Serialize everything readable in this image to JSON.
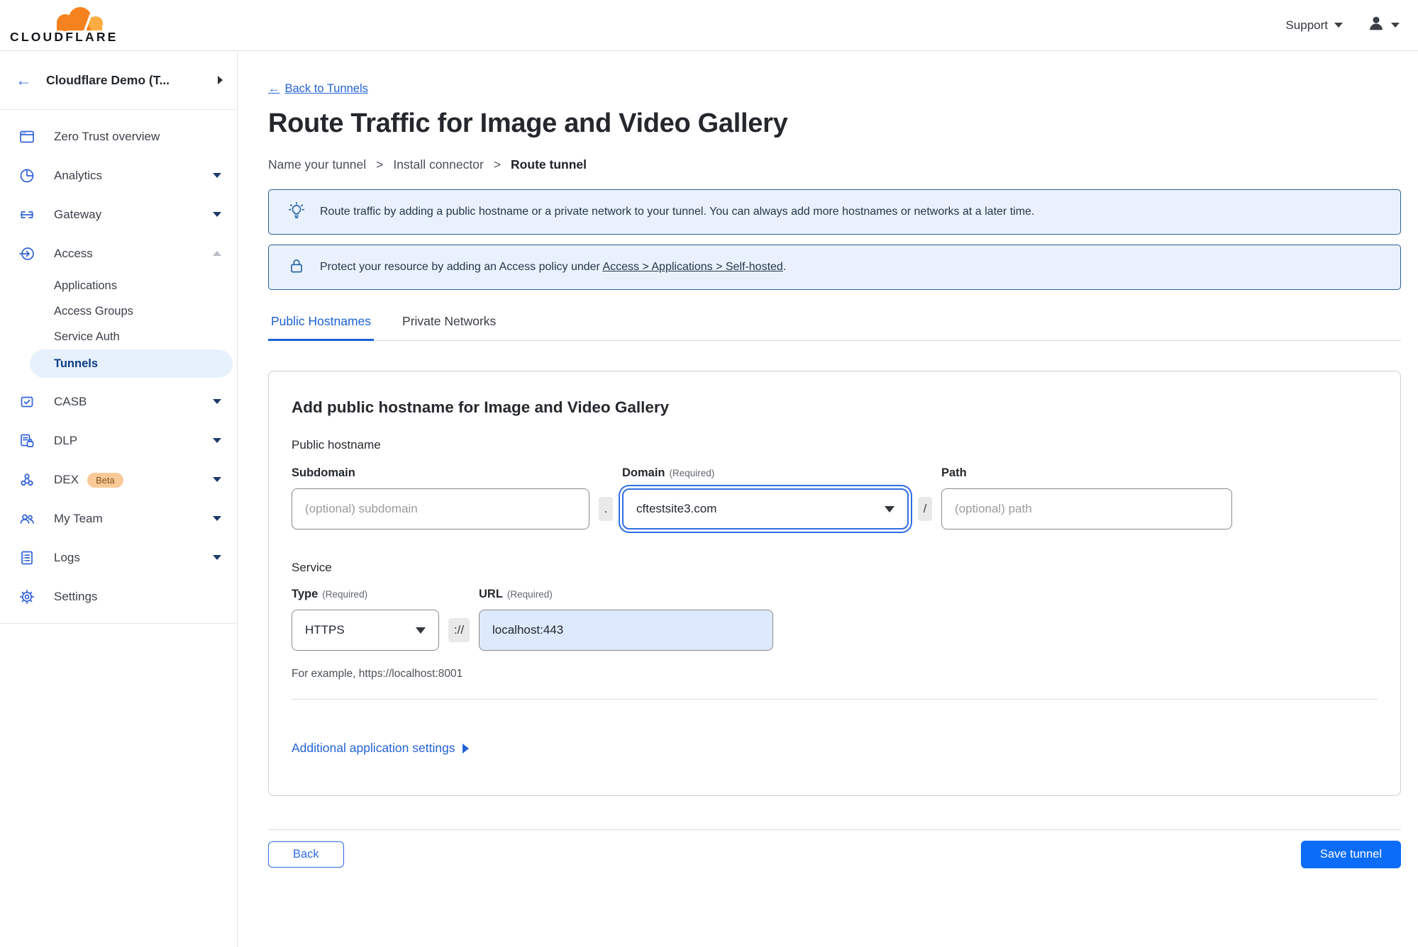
{
  "topbar": {
    "support_label": "Support"
  },
  "sidebar": {
    "account_name": "Cloudflare Demo (T...",
    "items": [
      {
        "label": "Zero Trust overview"
      },
      {
        "label": "Analytics"
      },
      {
        "label": "Gateway"
      },
      {
        "label": "Access"
      },
      {
        "label": "CASB"
      },
      {
        "label": "DLP"
      },
      {
        "label": "DEX",
        "badge": "Beta"
      },
      {
        "label": "My Team"
      },
      {
        "label": "Logs"
      },
      {
        "label": "Settings"
      }
    ],
    "access_sub_items": [
      {
        "label": "Applications"
      },
      {
        "label": "Access Groups"
      },
      {
        "label": "Service Auth"
      },
      {
        "label": "Tunnels",
        "active": true
      }
    ]
  },
  "main": {
    "back_link": "Back to Tunnels",
    "title": "Route Traffic for Image and Video Gallery",
    "steps": [
      "Name your tunnel",
      "Install connector",
      "Route tunnel"
    ],
    "steps_separator": ">",
    "banners": {
      "tip": "Route traffic by adding a public hostname or a private network to your tunnel. You can always add more hostnames or networks at a later time.",
      "protect_prefix": "Protect your resource by adding an Access policy under",
      "protect_link": "Access > Applications > Self-hosted",
      "protect_suffix": "."
    },
    "tabs": [
      {
        "label": "Public Hostnames",
        "active": true
      },
      {
        "label": "Private Networks",
        "active": false
      }
    ],
    "form": {
      "heading": "Add public hostname for Image and Video Gallery",
      "public_hostname_label": "Public hostname",
      "subdomain_label": "Subdomain",
      "subdomain_placeholder": "(optional) subdomain",
      "dot_separator": ".",
      "domain_label": "Domain",
      "required_label": "(Required)",
      "domain_value": "cftestsite3.com",
      "slash_separator": "/",
      "path_label": "Path",
      "path_placeholder": "(optional) path",
      "service_label": "Service",
      "type_label": "Type",
      "type_value": "HTTPS",
      "scheme_separator": "://",
      "url_label": "URL",
      "url_value": "localhost:443",
      "url_example": "For example, https://localhost:8001",
      "additional_settings_label": "Additional application settings"
    },
    "footer": {
      "back_button": "Back",
      "save_button": "Save tunnel"
    }
  },
  "icons": {
    "back_arrow": "←"
  },
  "colors": {
    "accent_blue": "#0b6cf9",
    "link_blue": "#2463d8",
    "active_tab_blue": "#1c61d3",
    "sidebar_icon_blue": "#3362d8",
    "active_item_bg": "#e7f1fc",
    "active_item_text": "#0b3b85",
    "banner_bg": "#e9f2fc",
    "banner_border": "#2b5e9a",
    "beta_badge_bg": "#f9c997",
    "beta_badge_text": "#85571c",
    "logo_orange": "#f6821f",
    "logo_light_orange": "#fbad41",
    "url_field_bg": "#dde9fc"
  }
}
